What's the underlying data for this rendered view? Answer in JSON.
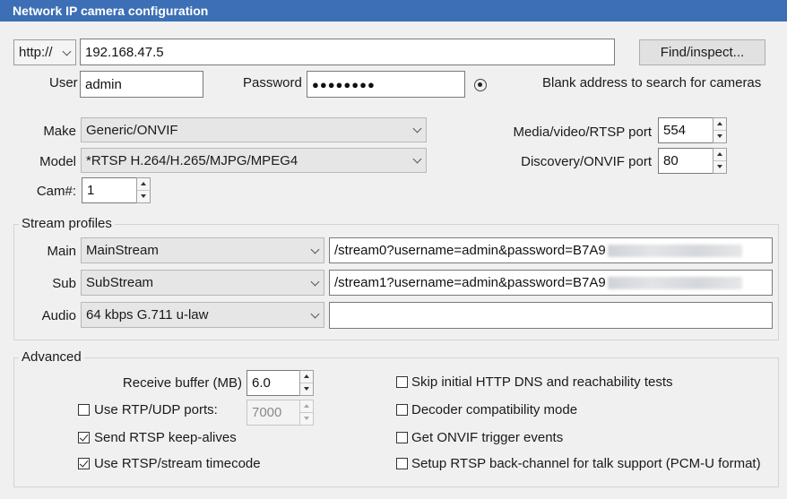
{
  "window": {
    "title": "Network IP camera configuration"
  },
  "connection": {
    "protocol": "http://",
    "address": "192.168.47.5",
    "find_label": "Find/inspect...",
    "user_label": "User",
    "user_value": "admin",
    "password_label": "Password",
    "password_value": "●●●●●●●●",
    "hint": "Blank address to search for cameras"
  },
  "device": {
    "make_label": "Make",
    "make_value": "Generic/ONVIF",
    "model_label": "Model",
    "model_value": "*RTSP H.264/H.265/MJPG/MPEG4",
    "cam_label": "Cam#:",
    "cam_value": "1",
    "media_port_label": "Media/video/RTSP port",
    "media_port_value": "554",
    "discovery_port_label": "Discovery/ONVIF port",
    "discovery_port_value": "80"
  },
  "stream_profiles": {
    "title": "Stream profiles",
    "main_label": "Main",
    "main_value": "MainStream",
    "main_path": "/stream0?username=admin&password=B7A9",
    "sub_label": "Sub",
    "sub_value": "SubStream",
    "sub_path": "/stream1?username=admin&password=B7A9",
    "audio_label": "Audio",
    "audio_value": "64 kbps G.711 u-law",
    "audio_path": ""
  },
  "advanced": {
    "title": "Advanced",
    "receive_buffer_label": "Receive buffer (MB)",
    "receive_buffer_value": "6.0",
    "rtp_udp_label": "Use RTP/UDP ports:",
    "rtp_udp_checked": false,
    "rtp_udp_value": "7000",
    "keepalive_label": "Send RTSP keep-alives",
    "keepalive_checked": true,
    "timecode_label": "Use RTSP/stream timecode",
    "timecode_checked": true,
    "skip_http_label": "Skip initial HTTP DNS and reachability tests",
    "skip_http_checked": false,
    "decoder_label": "Decoder compatibility mode",
    "decoder_checked": false,
    "onvif_events_label": "Get ONVIF trigger events",
    "onvif_events_checked": false,
    "backchannel_label": "Setup RTSP back-channel for talk support (PCM-U format)",
    "backchannel_checked": false
  },
  "colors": {
    "titlebar": "#3c6fb5",
    "background": "#f0f0f0"
  }
}
